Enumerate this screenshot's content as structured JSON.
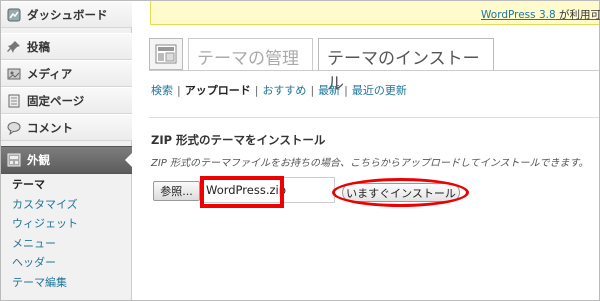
{
  "sidebar": {
    "items": [
      {
        "label": "ダッシュボード",
        "icon": "dashboard-icon"
      },
      {
        "label": "投稿",
        "icon": "pin-icon"
      },
      {
        "label": "メディア",
        "icon": "media-icon"
      },
      {
        "label": "固定ページ",
        "icon": "page-icon"
      },
      {
        "label": "コメント",
        "icon": "comment-icon"
      },
      {
        "label": "外観",
        "icon": "appearance-icon"
      }
    ],
    "submenu": [
      "テーマ",
      "カスタマイズ",
      "ウィジェット",
      "メニュー",
      "ヘッダー",
      "テーマ編集"
    ]
  },
  "notice": {
    "link": "WordPress 3.8",
    "rest": " が利用可"
  },
  "tabs": {
    "manage": "テーマの管理",
    "install": "テーマのインストール"
  },
  "subnav": {
    "search": "検索",
    "upload": "アップロード",
    "featured": "おすすめ",
    "newest": "最新",
    "updated": "最近の更新",
    "separator": "|"
  },
  "upload": {
    "title": "ZIP 形式のテーマをインストール",
    "description": "ZIP 形式のテーマファイルをお持ちの場合、こちらからアップロードしてインストールできます。",
    "browse_label": "参照...",
    "file_value": "WordPress.zip",
    "install_label": "いますぐインストール"
  },
  "colors": {
    "link": "#21759b",
    "highlight": "#e00000",
    "notice_bg": "#fffbcc"
  }
}
